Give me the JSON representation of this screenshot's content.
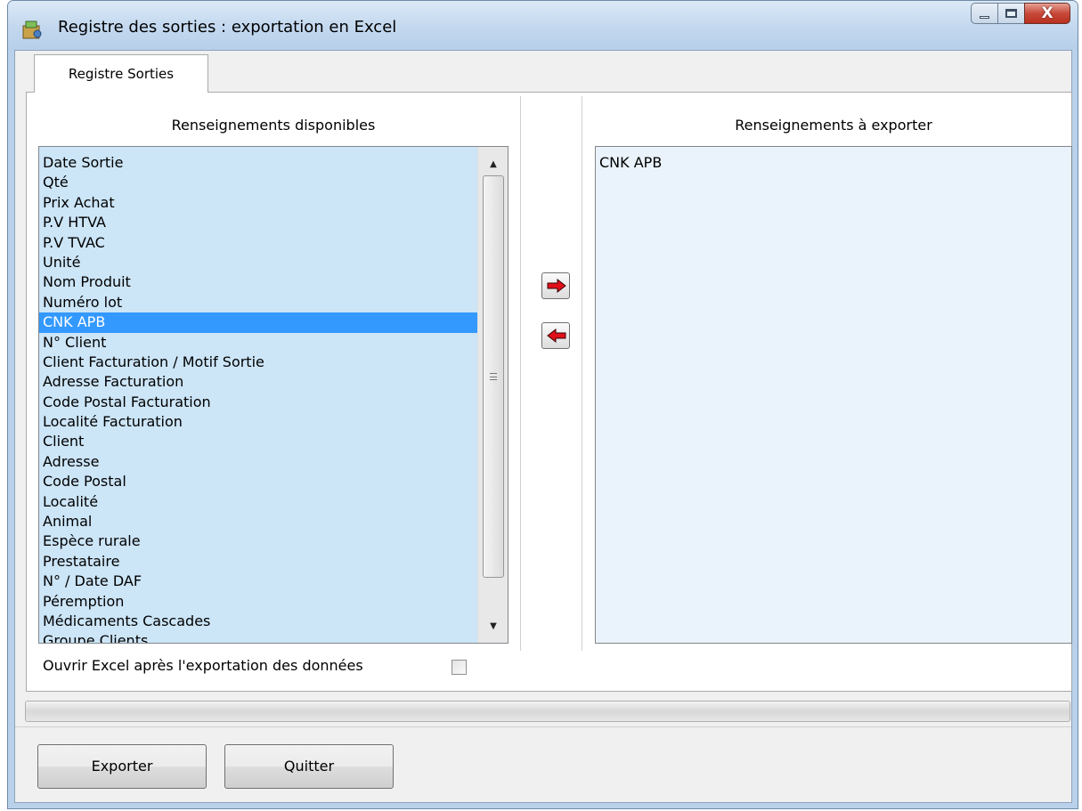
{
  "window": {
    "title": "Registre des sorties : exportation en Excel",
    "close_glyph": "X"
  },
  "tabs": [
    {
      "label": "Registre Sorties",
      "active": true
    }
  ],
  "available": {
    "header": "Renseignements disponibles",
    "items": [
      "Date Sortie",
      "Qté",
      "Prix Achat",
      "P.V HTVA",
      "P.V TVAC",
      "Unité",
      "Nom Produit",
      "Numéro lot",
      "CNK APB",
      "N° Client",
      "Client Facturation / Motif Sortie",
      "Adresse Facturation",
      "Code Postal Facturation",
      "Localité Facturation",
      "Client",
      "Adresse",
      "Code Postal",
      "Localité",
      "Animal",
      "Espèce rurale",
      "Prestataire",
      "N° / Date DAF",
      "Péremption",
      "Médicaments Cascades",
      "Groupe Clients"
    ],
    "selected_index": 8
  },
  "export": {
    "header": "Renseignements à exporter",
    "items": [
      "CNK APB"
    ]
  },
  "actions": {
    "add_icon": "arrow-right-icon",
    "remove_icon": "arrow-left-icon"
  },
  "options": {
    "open_excel_label": "Ouvrir Excel après l'exportation des données",
    "open_excel_checked": false
  },
  "progress": {
    "value": 0
  },
  "buttons": {
    "export_label": "Exporter",
    "quit_label": "Quitter"
  },
  "colors": {
    "selection": "#3399ff",
    "available_list_bg": "#cce5f7",
    "export_list_bg": "#eaf3fb",
    "arrow_red": "#e0101a"
  }
}
